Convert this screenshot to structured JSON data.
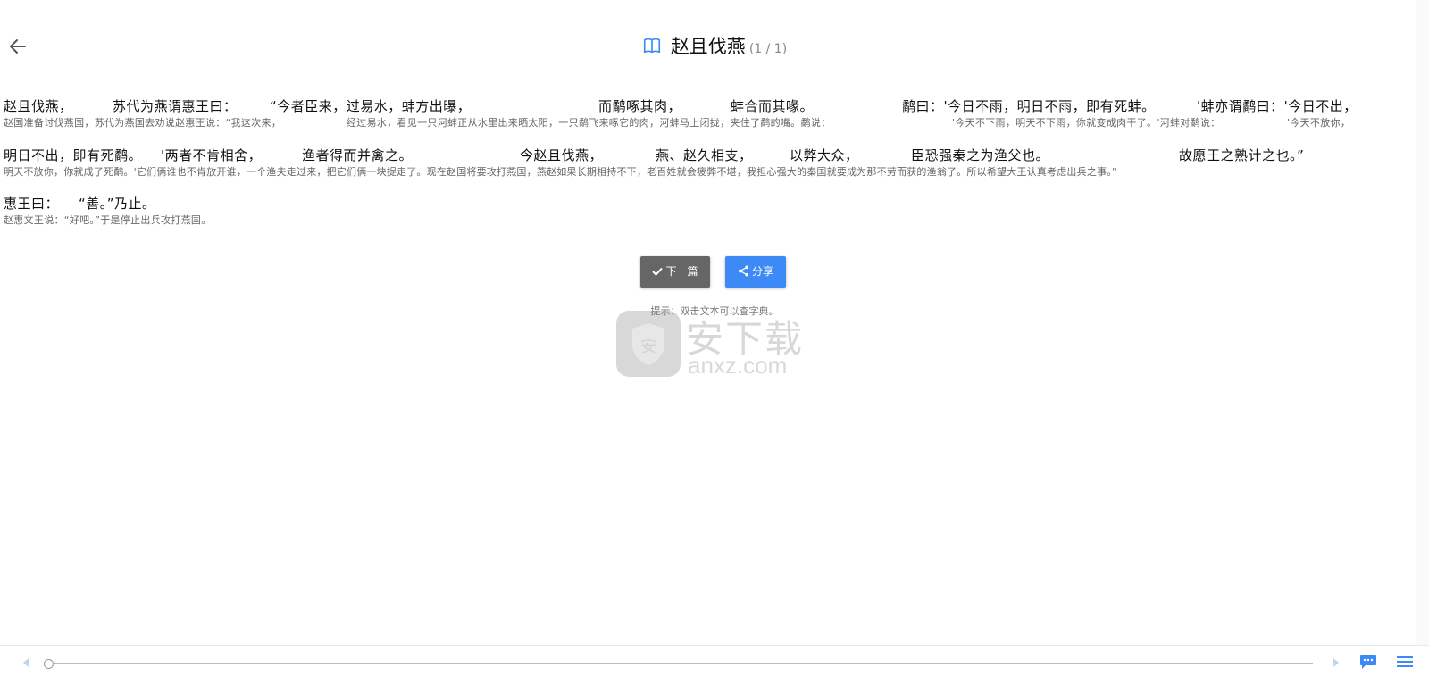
{
  "header": {
    "title": "赵且伐燕",
    "count": "(1 / 1)"
  },
  "lines": [
    {
      "orig": [
        {
          "text": "赵且伐燕，"
        },
        {
          "text": "苏代为燕谓惠王曰："
        },
        {
          "text": "“今者臣来，过易水，蚌方出曝，"
        },
        {
          "text": "而鹬啄其肉，"
        },
        {
          "text": "蚌合而其喙。"
        },
        {
          "text": "鹬曰：'今日不雨，明日不雨，即有死蚌。"
        },
        {
          "text": "'蚌亦谓鹬曰：'今日不出，"
        }
      ],
      "trans": [
        {
          "text": "赵国准备讨伐燕国，苏代为燕国去劝说赵惠王说：“我这次来，"
        },
        {
          "text": "经过易水，看见一只河蚌正从水里出来晒太阳，一只鹬飞来啄它的肉，河蚌马上闭拢，夹住了鹬的嘴。鹬说："
        },
        {
          "text": "'今天不下雨，明天不下雨，你就变成肉干了。'河蚌对鹬说："
        },
        {
          "text": "'今天不放你，"
        }
      ]
    },
    {
      "orig": [
        {
          "text": "明日不出，即有死鹬。"
        },
        {
          "text": "'两者不肯相舍，"
        },
        {
          "text": "渔者得而并禽之。"
        },
        {
          "text": "今赵且伐燕，"
        },
        {
          "text": "燕、赵久相支，"
        },
        {
          "text": "以弊大众，"
        },
        {
          "text": "臣恐强秦之为渔父也。"
        },
        {
          "text": "故愿王之熟计之也。”"
        }
      ],
      "trans": [
        {
          "text": "明天不放你，你就成了死鹬。'它们俩谁也不肯放开谁，一个渔夫走过来，把它们俩一块捉走了。现在赵国将要攻打燕国，燕赵如果长期相持不下，老百姓就会疲弊不堪，我担心强大的秦国就要成为那不劳而获的渔翁了。所以希望大王认真考虑出兵之事。”"
        }
      ]
    },
    {
      "orig": [
        {
          "text": "惠王曰："
        },
        {
          "text": "“善。”乃止。"
        }
      ],
      "trans": [
        {
          "text": "赵惠文王说：“好吧。”于是停止出兵攻打燕国。"
        }
      ]
    }
  ],
  "buttons": {
    "next": "下一篇",
    "share": "分享"
  },
  "hint": "提示：双击文本可以查字典。",
  "watermark": {
    "cn": "安下载",
    "en": "anxz.com",
    "shield": "安"
  },
  "slider": {
    "position": 0
  },
  "colors": {
    "accent": "#3d8af7",
    "next_button": "#666666"
  },
  "icons": [
    "back-arrow-icon",
    "book-icon",
    "check-icon",
    "share-icon",
    "prev-arrow-icon",
    "next-arrow-icon",
    "comment-icon",
    "menu-icon"
  ]
}
